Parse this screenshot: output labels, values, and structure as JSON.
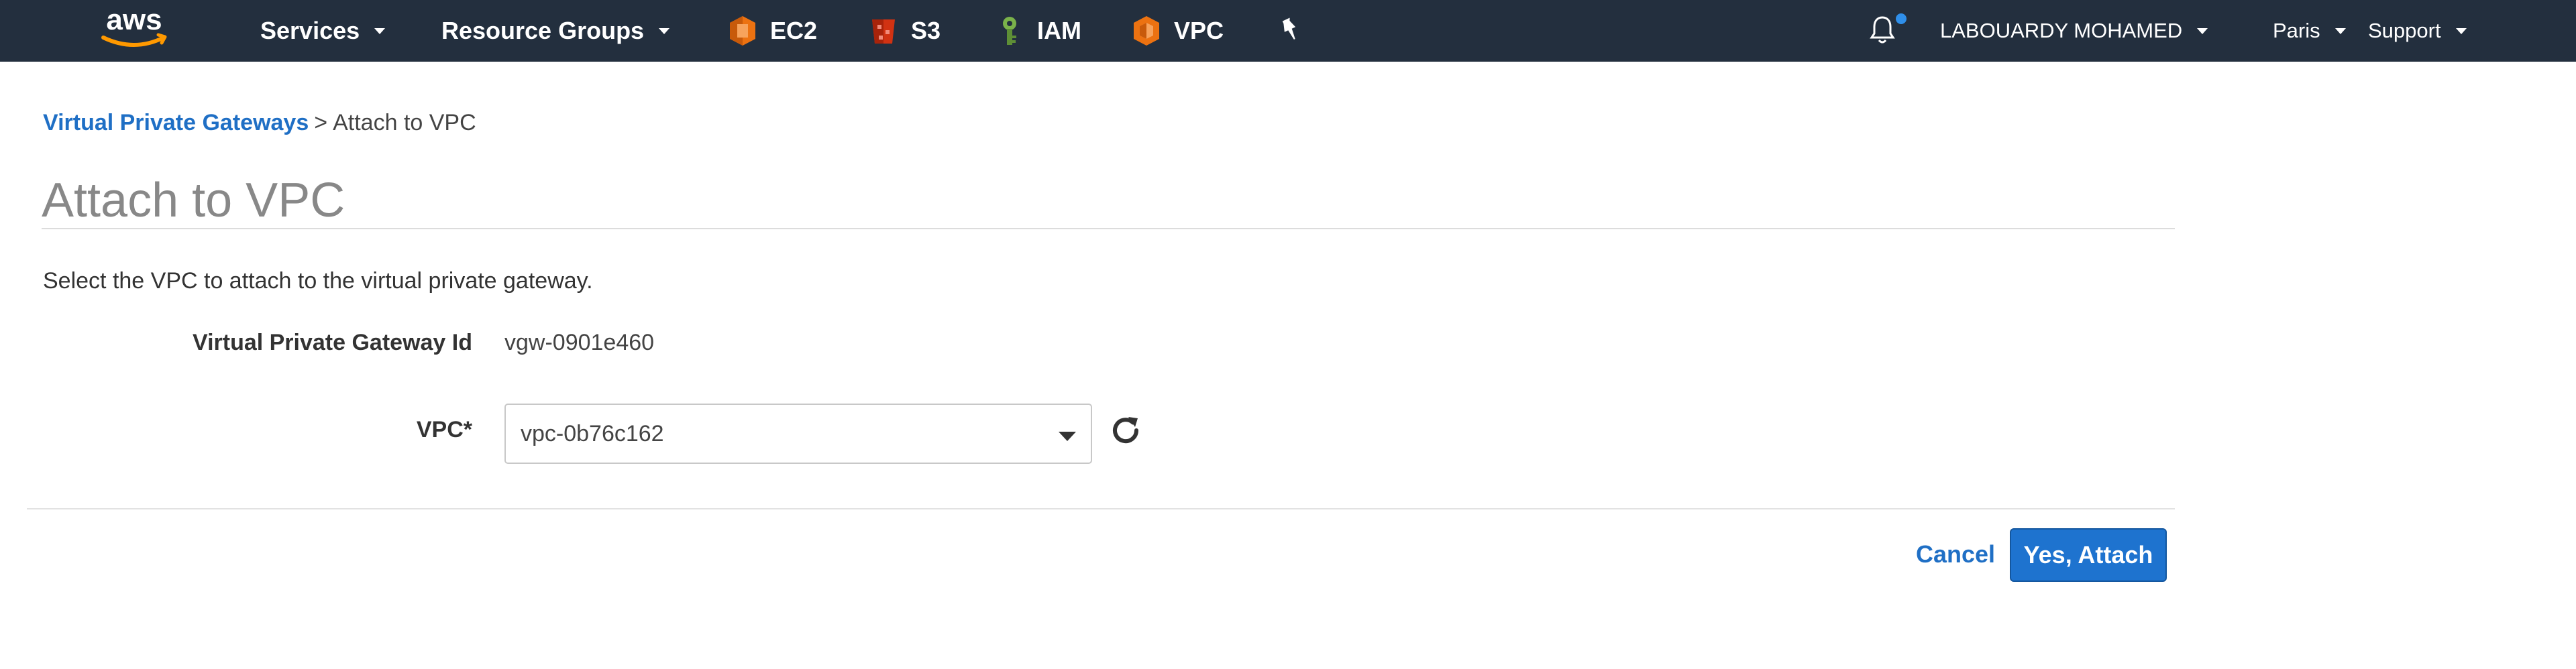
{
  "topnav": {
    "logo_text": "aws",
    "services_label": "Services",
    "resource_groups_label": "Resource Groups",
    "shortcuts": [
      {
        "label": "EC2",
        "icon": "ec2-icon",
        "color": "#ec7211"
      },
      {
        "label": "S3",
        "icon": "s3-icon",
        "color": "#d13212"
      },
      {
        "label": "IAM",
        "icon": "iam-icon",
        "color": "#6b9e3e"
      },
      {
        "label": "VPC",
        "icon": "vpc-icon",
        "color": "#ec7211"
      }
    ],
    "pin_icon": "pushpin-icon",
    "notifications_icon": "bell-icon",
    "user_label": "LABOUARDY MOHAMED",
    "region_label": "Paris",
    "support_label": "Support"
  },
  "breadcrumb": {
    "parent": "Virtual Private Gateways",
    "separator": ">",
    "current": "Attach to VPC"
  },
  "page": {
    "title": "Attach to VPC",
    "description": "Select the VPC to attach to the virtual private gateway."
  },
  "form": {
    "gateway_id_label": "Virtual Private Gateway Id",
    "gateway_id_value": "vgw-0901e460",
    "vpc_label": "VPC*",
    "vpc_selected": "vpc-0b76c162"
  },
  "actions": {
    "cancel_label": "Cancel",
    "submit_label": "Yes, Attach"
  },
  "colors": {
    "nav_bg": "#232f3e",
    "link": "#1f6fc5",
    "primary_button": "#1e73cf",
    "notification_dot": "#2f8fea"
  }
}
